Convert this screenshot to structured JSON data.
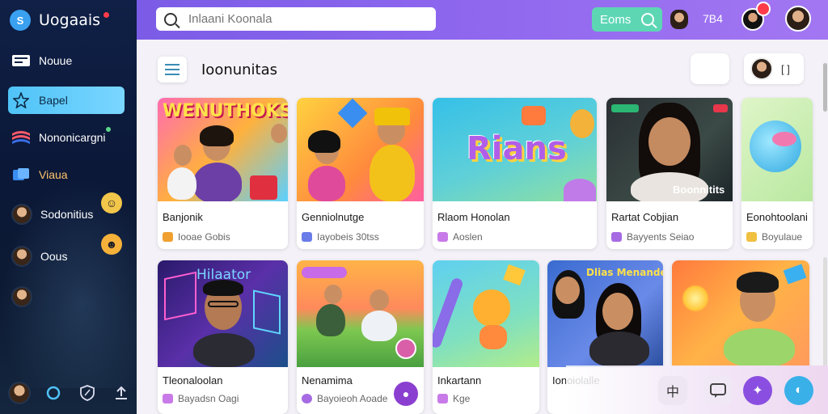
{
  "app": {
    "name": "Uogaais"
  },
  "sidebar": {
    "items": [
      {
        "label": "Nouue",
        "icon": "list-icon"
      },
      {
        "label": "Bapel",
        "icon": "star-icon"
      },
      {
        "label": "Nononicargni",
        "icon": "flag-icon"
      },
      {
        "label": "Viaua",
        "icon": "cards-icon"
      },
      {
        "label": "Sodonitius",
        "icon": "avatar"
      },
      {
        "label": "Oous",
        "icon": "avatar"
      }
    ],
    "bottom": [
      "avatar",
      "chat-icon",
      "shield-icon",
      "upload-icon"
    ]
  },
  "topbar": {
    "search_placeholder": "Inlaani Koonala",
    "button_label": "Eoms",
    "count": "7B4"
  },
  "main": {
    "title": "Ioonunitas",
    "user_label": "[ ]"
  },
  "cards_row1": [
    {
      "thumb_title": "WENUTHOKS",
      "title": "Banjonik",
      "meta": "Iooae Gobis",
      "heart_color": "#f0a030"
    },
    {
      "thumb_title": "",
      "title": "Genniolnutge",
      "meta": "Iayobeis 30tss",
      "heart_color": "#6a7ce8"
    },
    {
      "thumb_title": "Rians",
      "title": "Rlaom Honolan",
      "meta": "Aoslen",
      "heart_color": "#c87be8"
    },
    {
      "thumb_title": "Boonnitits",
      "title": "Rartat Cobjian",
      "meta": "Bayyents Seiao",
      "heart_color": "#a66be2"
    },
    {
      "thumb_title": "",
      "title": "Eonohtoolani",
      "meta": "Boyulaue",
      "heart_color": "#f0c040"
    }
  ],
  "cards_row2": [
    {
      "thumb_title": "Hilaator",
      "title": "Tleonaloolan",
      "meta": "Bayadsn Oagi",
      "heart_color": "#c87be8"
    },
    {
      "thumb_title": "",
      "title": "Nenamima",
      "meta": "Bayoieoh Aoade",
      "heart_color": "#a66be2"
    },
    {
      "thumb_title": "",
      "title": "Inkartann",
      "meta": "Kge",
      "heart_color": "#c87be8"
    },
    {
      "thumb_title": "Dlias Menande",
      "title": "Ionoiolalle",
      "meta": "",
      "heart_color": "#999"
    },
    {
      "thumb_title": "",
      "title": "",
      "meta": "",
      "heart_color": "#999"
    }
  ],
  "dock": [
    "translate-icon",
    "message-icon",
    "puzzle-icon",
    "globe-icon"
  ]
}
